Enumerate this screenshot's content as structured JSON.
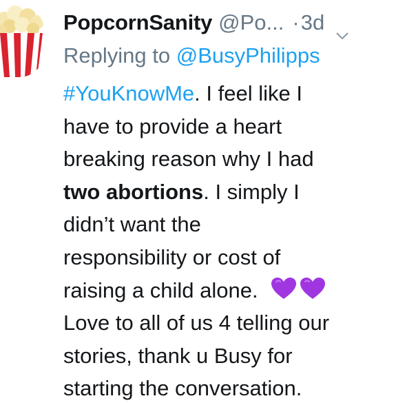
{
  "author": {
    "display_name": "PopcornSanity",
    "handle": "@Po...",
    "separator": "·",
    "timestamp": "3d",
    "avatar_icon": "popcorn-box-icon"
  },
  "reply": {
    "prefix": "Replying to ",
    "mention": "@BusyPhilipps"
  },
  "tweet": {
    "hashtag": "#YouKnowMe",
    "line1_rest": ". I feel like I",
    "line2": "have to provide a heart",
    "line3": "breaking reason why I had",
    "line4_bold": "two abortions",
    "line4_rest": ".  I simply I",
    "line5": "didn’t want the",
    "line6": "responsibility or cost of",
    "line7": "raising a child alone.",
    "line8": "Love to all of us 4 telling our",
    "line9": "stories, thank u Busy for",
    "line10": "starting the conversation.",
    "emoji": [
      "purple-heart-icon",
      "purple-heart-icon"
    ]
  },
  "colors": {
    "link": "#1da1f2",
    "secondary_text": "#657786",
    "primary_text": "#14171a",
    "purple_heart": "#a036e0",
    "popcorn_red": "#d9232e"
  }
}
